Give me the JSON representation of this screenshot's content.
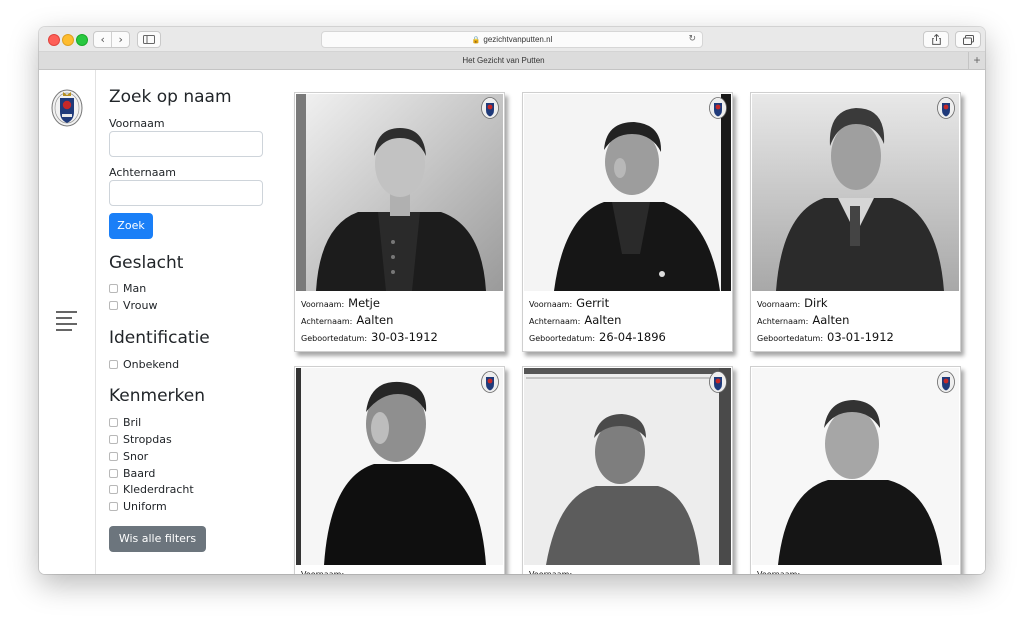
{
  "browser": {
    "url": "gezichtvanputten.nl",
    "tab_title": "Het Gezicht van Putten"
  },
  "search": {
    "heading": "Zoek op naam",
    "first_name_label": "Voornaam",
    "first_name_value": "",
    "last_name_label": "Achternaam",
    "last_name_value": "",
    "button_label": "Zoek"
  },
  "gender": {
    "heading": "Geslacht",
    "options": [
      "Man",
      "Vrouw"
    ]
  },
  "identification": {
    "heading": "Identificatie",
    "options": [
      "Onbekend"
    ]
  },
  "features": {
    "heading": "Kenmerken",
    "options": [
      "Bril",
      "Stropdas",
      "Snor",
      "Baard",
      "Klederdracht",
      "Uniform"
    ]
  },
  "clear_button_label": "Wis alle filters",
  "card_labels": {
    "first_name": "Voornaam:",
    "last_name": "Achternaam:",
    "birth_date": "Geboortedatum:"
  },
  "people": [
    {
      "first_name": "Metje",
      "last_name": "Aalten",
      "birth_date": "30-03-1912"
    },
    {
      "first_name": "Gerrit",
      "last_name": "Aalten",
      "birth_date": "26-04-1896"
    },
    {
      "first_name": "Dirk",
      "last_name": "Aalten",
      "birth_date": "03-01-1912"
    },
    {
      "first_name": "",
      "last_name": "",
      "birth_date": ""
    },
    {
      "first_name": "",
      "last_name": "",
      "birth_date": ""
    },
    {
      "first_name": "",
      "last_name": "",
      "birth_date": ""
    }
  ],
  "colors": {
    "primary_button": "#1a7ff7",
    "secondary_button": "#6c757d"
  },
  "icons": {
    "logo": "putten-crest-logo",
    "menu": "hamburger-menu-icon",
    "card_badge": "crest-badge-icon"
  }
}
